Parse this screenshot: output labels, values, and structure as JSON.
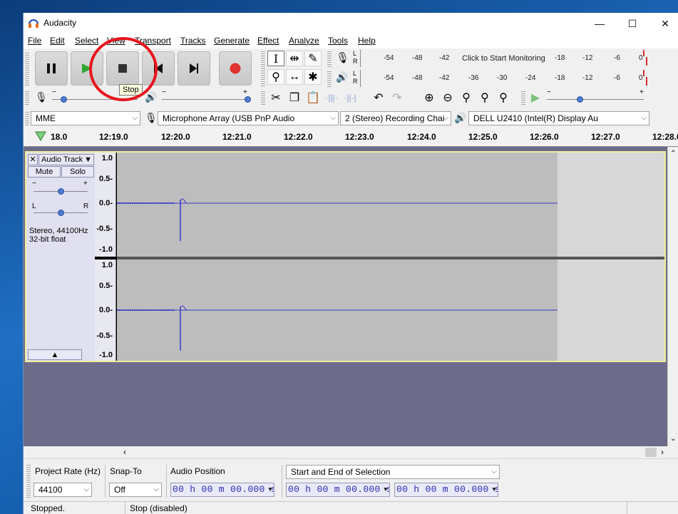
{
  "window": {
    "title": "Audacity",
    "controls": [
      "—",
      "☐",
      "✕"
    ]
  },
  "menu": [
    "File",
    "Edit",
    "Select",
    "View",
    "Transport",
    "Tracks",
    "Generate",
    "Effect",
    "Analyze",
    "Tools",
    "Help"
  ],
  "tooltip": "Stop",
  "meters": {
    "record_ticks": [
      "-54",
      "-48",
      "-42",
      "Click to Start Monitoring",
      "-18",
      "-12",
      "-6",
      "0"
    ],
    "play_ticks": [
      "-54",
      "-48",
      "-42",
      "-36",
      "-30",
      "-24",
      "-18",
      "-12",
      "-6",
      "0"
    ],
    "channel_left": "L",
    "channel_right": "R"
  },
  "device": {
    "host": "MME",
    "input": "Microphone Array (USB PnP Audio",
    "channels": "2 (Stereo) Recording Chai",
    "output": "DELL U2410 (Intel(R) Display Au"
  },
  "ruler": [
    "18.0",
    "12:19.0",
    "12:20.0",
    "12:21.0",
    "12:22.0",
    "12:23.0",
    "12:24.0",
    "12:25.0",
    "12:26.0",
    "12:27.0",
    "12:28.0"
  ],
  "track": {
    "name": "Audio Track",
    "mute": "Mute",
    "solo": "Solo",
    "gain_minus": "−",
    "gain_plus": "+",
    "pan_l": "L",
    "pan_r": "R",
    "info1": "Stereo, 44100Hz",
    "info2": "32-bit float",
    "scale": [
      "1.0",
      "0.5-",
      "0.0-",
      "-0.5-",
      "-1.0"
    ]
  },
  "selection": {
    "project_rate_label": "Project Rate (Hz)",
    "project_rate": "44100",
    "snap_label": "Snap-To",
    "snap": "Off",
    "audio_position_label": "Audio Position",
    "audio_position": "00 h 00 m 00.000 s",
    "selection_mode": "Start and End of Selection",
    "sel_start": "00 h 00 m 00.000 s",
    "sel_end": "00 h 00 m 00.000 s"
  },
  "status": {
    "state": "Stopped.",
    "hint": "Stop (disabled)"
  },
  "colors": {
    "waveform": "#3a3ac8",
    "record": "#e0322e",
    "play_green": "#2fa82f",
    "callout": "#e8141e"
  }
}
